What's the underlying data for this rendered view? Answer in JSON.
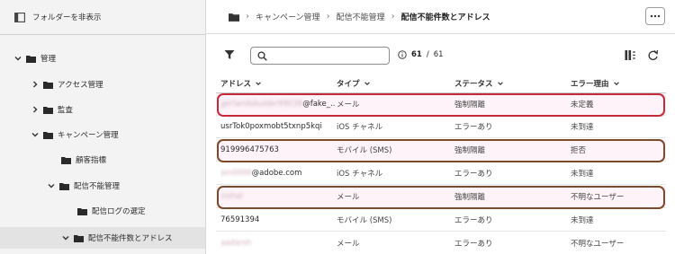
{
  "sidebar": {
    "hide_folders_label": "フォルダーを非表示",
    "items": [
      {
        "label": "管理",
        "depth": 0,
        "expanded": true
      },
      {
        "label": "アクセス管理",
        "depth": 1,
        "expanded": false
      },
      {
        "label": "監査",
        "depth": 1,
        "expanded": false
      },
      {
        "label": "キャンペーン管理",
        "depth": 1,
        "expanded": true
      },
      {
        "label": "顧客指標",
        "depth": 2,
        "expanded": null
      },
      {
        "label": "配信不能管理",
        "depth": 2,
        "expanded": true
      },
      {
        "label": "配信ログの選定",
        "depth": 3,
        "expanded": null
      },
      {
        "label": "配信不能件数とアドレス",
        "depth": 3,
        "expanded": false,
        "selected": true
      }
    ]
  },
  "breadcrumb": {
    "items": [
      "キャンペーン管理",
      "配信不能管理"
    ],
    "current": "配信不能件数とアドレス"
  },
  "toolbar": {
    "search_value": "",
    "count_shown": "61",
    "count_sep": "/",
    "count_total": "61"
  },
  "table": {
    "columns": [
      {
        "label": "アドレス"
      },
      {
        "label": "タイプ"
      },
      {
        "label": "ステータス"
      },
      {
        "label": "エラー理由"
      }
    ],
    "rows": [
      {
        "address_redacted": "gerlandsbulder99038",
        "address": "@fake_...",
        "type": "メール",
        "status": "強制隔離",
        "reason": "未定義"
      },
      {
        "address_redacted": "",
        "address": "usrTok0poxmobt5txnp5kqi",
        "type": "iOS チャネル",
        "status": "エラーあり",
        "reason": "未到達"
      },
      {
        "address_redacted": "",
        "address": "919996475763",
        "type": "モバイル (SMS)",
        "status": "強制隔離",
        "reason": "拒否"
      },
      {
        "address_redacted": "jon0000",
        "address": "@adobe.com",
        "type": "iOS チャネル",
        "status": "エラーあり",
        "reason": "未到達"
      },
      {
        "address_redacted": "vishal",
        "address": "",
        "type": "メール",
        "status": "強制隔離",
        "reason": "不明なユーザー"
      },
      {
        "address_redacted": "",
        "address": "76591394",
        "type": "モバイル (SMS)",
        "status": "エラーあり",
        "reason": "未到達"
      },
      {
        "address_redacted": "aadarsh",
        "address": "",
        "type": "メール",
        "status": "エラーあり",
        "reason": "不明なユーザー"
      }
    ]
  },
  "colors": {
    "highlight_red": "#c42a3a",
    "highlight_brown": "#7a4a2a",
    "row_tint": "#fdf3f8"
  },
  "icons": [
    "sidebar-toggle-icon",
    "folder-icon",
    "chevron-down-icon",
    "chevron-right-icon",
    "more-icon",
    "filter-icon",
    "search-icon",
    "info-icon",
    "column-settings-icon",
    "refresh-icon"
  ]
}
